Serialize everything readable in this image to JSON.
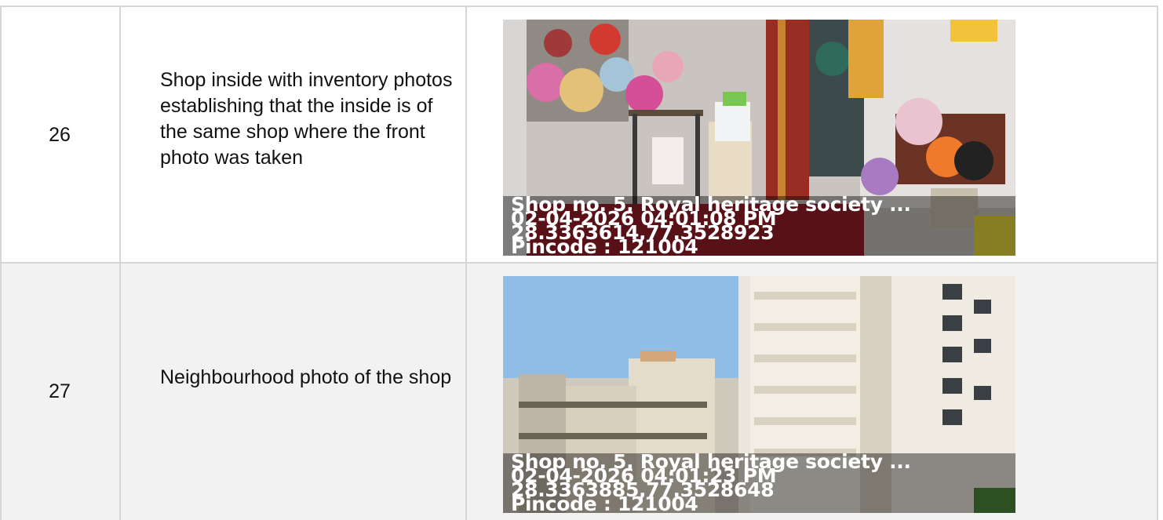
{
  "rows": [
    {
      "number": "26",
      "description": "Shop inside with inventory photos establishing that the inside is of the same shop where the front photo was taken",
      "photo": {
        "alt": "shop interior with inventory",
        "stamp": {
          "address": "Shop no. 5, Royal heritage society ...",
          "datetime": "02-04-2026 04:01:08 PM",
          "coordinates": "28.3363614,77.3528923",
          "pincode": "Pincode : 121004"
        }
      }
    },
    {
      "number": "27",
      "description": "Neighbourhood photo of the shop",
      "photo": {
        "alt": "residential towers near the shop",
        "stamp": {
          "address": "Shop no. 5, Royal heritage society ...",
          "datetime": "02-04-2026 04:01:23 PM",
          "coordinates": "28.3363885,77.3528648",
          "pincode": "Pincode : 121004"
        }
      }
    }
  ]
}
